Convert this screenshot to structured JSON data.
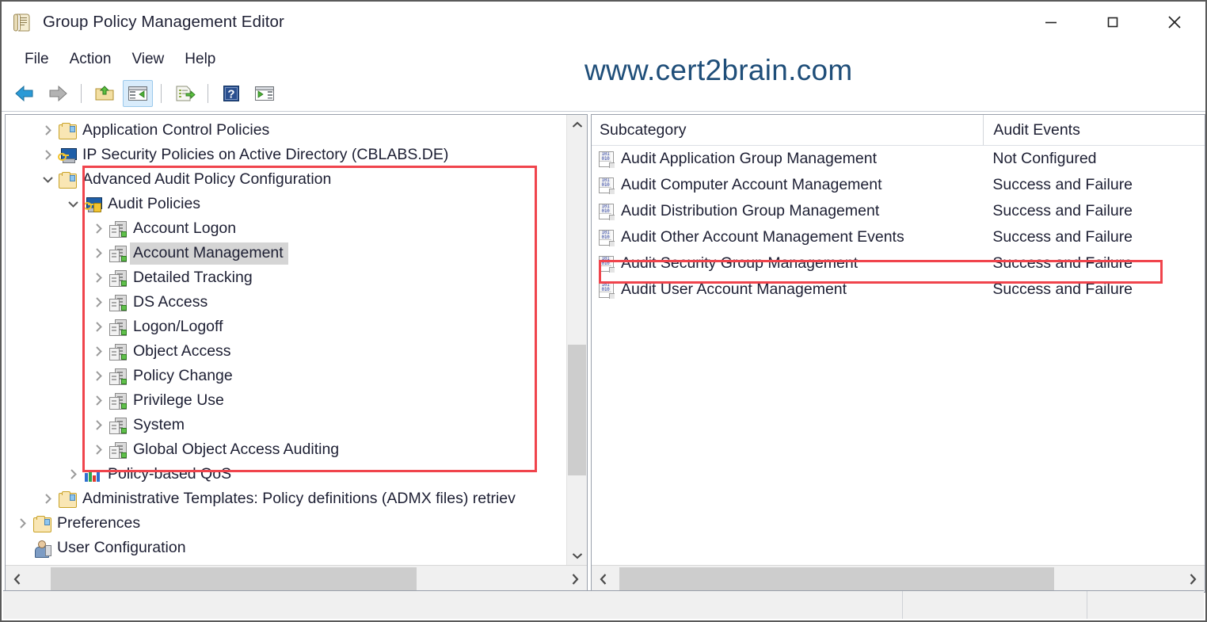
{
  "window": {
    "title": "Group Policy Management Editor",
    "icon": "policy-editor-icon",
    "minimize_label": "—",
    "maximize_label": "□",
    "close_label": "✕"
  },
  "watermark": {
    "text": "www.cert2brain.com",
    "color": "#1f4e79"
  },
  "menubar": {
    "items": [
      {
        "label": "File",
        "name": "menu-file"
      },
      {
        "label": "Action",
        "name": "menu-action"
      },
      {
        "label": "View",
        "name": "menu-view"
      },
      {
        "label": "Help",
        "name": "menu-help"
      }
    ]
  },
  "toolbar": {
    "buttons": [
      {
        "name": "back-button",
        "icon": "back-arrow-icon",
        "tooltip": "Back"
      },
      {
        "name": "forward-button",
        "icon": "forward-arrow-icon",
        "tooltip": "Forward"
      },
      {
        "name": "up-one-level-button",
        "icon": "folder-up-icon",
        "tooltip": "Up One Level"
      },
      {
        "name": "show-hide-console-tree-button",
        "icon": "console-tree-icon",
        "tooltip": "Show/Hide Console Tree",
        "active": true
      },
      {
        "name": "export-list-button",
        "icon": "export-list-icon",
        "tooltip": "Export List"
      },
      {
        "name": "help-button",
        "icon": "help-question-icon",
        "tooltip": "Help"
      },
      {
        "name": "show-action-pane-button",
        "icon": "action-pane-icon",
        "tooltip": "Show/Hide Action Pane"
      }
    ]
  },
  "tree": {
    "items": [
      {
        "label": "Application Control Policies",
        "indent": 1,
        "twisty": "collapsed",
        "icon": "folder-icon",
        "selected": false
      },
      {
        "label": "IP Security Policies on Active Directory (CBLABS.DE)",
        "indent": 1,
        "twisty": "collapsed",
        "icon": "ip-security-icon",
        "selected": false
      },
      {
        "label": "Advanced Audit Policy Configuration",
        "indent": 1,
        "twisty": "expanded",
        "icon": "folder-icon",
        "selected": false
      },
      {
        "label": "Audit Policies",
        "indent": 2,
        "twisty": "expanded",
        "icon": "audit-policies-icon",
        "selected": false
      },
      {
        "label": "Account Logon",
        "indent": 3,
        "twisty": "collapsed",
        "icon": "server-icon",
        "selected": false
      },
      {
        "label": "Account Management",
        "indent": 3,
        "twisty": "collapsed",
        "icon": "server-icon",
        "selected": true
      },
      {
        "label": "Detailed Tracking",
        "indent": 3,
        "twisty": "collapsed",
        "icon": "server-icon",
        "selected": false
      },
      {
        "label": "DS Access",
        "indent": 3,
        "twisty": "collapsed",
        "icon": "server-icon",
        "selected": false
      },
      {
        "label": "Logon/Logoff",
        "indent": 3,
        "twisty": "collapsed",
        "icon": "server-icon",
        "selected": false
      },
      {
        "label": "Object Access",
        "indent": 3,
        "twisty": "collapsed",
        "icon": "server-icon",
        "selected": false
      },
      {
        "label": "Policy Change",
        "indent": 3,
        "twisty": "collapsed",
        "icon": "server-icon",
        "selected": false
      },
      {
        "label": "Privilege Use",
        "indent": 3,
        "twisty": "collapsed",
        "icon": "server-icon",
        "selected": false
      },
      {
        "label": "System",
        "indent": 3,
        "twisty": "collapsed",
        "icon": "server-icon",
        "selected": false
      },
      {
        "label": "Global Object Access Auditing",
        "indent": 3,
        "twisty": "collapsed",
        "icon": "server-icon",
        "selected": false
      },
      {
        "label": "Policy-based QoS",
        "indent": 2,
        "twisty": "collapsed",
        "icon": "qos-bars-icon",
        "selected": false
      },
      {
        "label": "Administrative Templates: Policy definitions (ADMX files) retriev",
        "indent": 1,
        "twisty": "collapsed",
        "icon": "folder-icon",
        "selected": false
      },
      {
        "label": "Preferences",
        "indent": 0,
        "twisty": "collapsed",
        "icon": "folder-icon",
        "selected": false
      },
      {
        "label": "User Configuration",
        "indent": 0,
        "twisty": "none",
        "icon": "user-configuration-icon",
        "selected": false
      }
    ]
  },
  "list": {
    "columns": [
      {
        "label": "Subcategory",
        "name": "column-subcategory"
      },
      {
        "label": "Audit Events",
        "name": "column-audit-events"
      }
    ],
    "rows": [
      {
        "subcategory": "Audit Application Group Management",
        "audit_events": "Not Configured",
        "icon": "audit-policy-icon",
        "highlighted": false
      },
      {
        "subcategory": "Audit Computer Account Management",
        "audit_events": "Success and Failure",
        "icon": "audit-policy-icon",
        "highlighted": false
      },
      {
        "subcategory": "Audit Distribution Group Management",
        "audit_events": "Success and Failure",
        "icon": "audit-policy-icon",
        "highlighted": false
      },
      {
        "subcategory": "Audit Other Account Management Events",
        "audit_events": "Success and Failure",
        "icon": "audit-policy-icon",
        "highlighted": false
      },
      {
        "subcategory": "Audit Security Group Management",
        "audit_events": "Success and Failure",
        "icon": "audit-policy-icon",
        "highlighted": true
      },
      {
        "subcategory": "Audit User Account Management",
        "audit_events": "Success and Failure",
        "icon": "audit-policy-icon",
        "highlighted": false
      }
    ]
  },
  "annotations": {
    "color": "#f0444c",
    "boxes": [
      {
        "name": "advanced-audit-policy-highlight",
        "target": "tree-advanced-audit-policy-configuration"
      },
      {
        "name": "audit-security-group-management-highlight",
        "target": "list-row-audit-security-group-management"
      }
    ]
  },
  "scrollbars": {
    "tree_vertical": {
      "name": "tree-vertical-scrollbar"
    },
    "tree_horizontal": {
      "name": "tree-horizontal-scrollbar"
    },
    "list_horizontal": {
      "name": "list-horizontal-scrollbar"
    }
  },
  "statusbar": {
    "panes": [
      "",
      "",
      ""
    ]
  }
}
